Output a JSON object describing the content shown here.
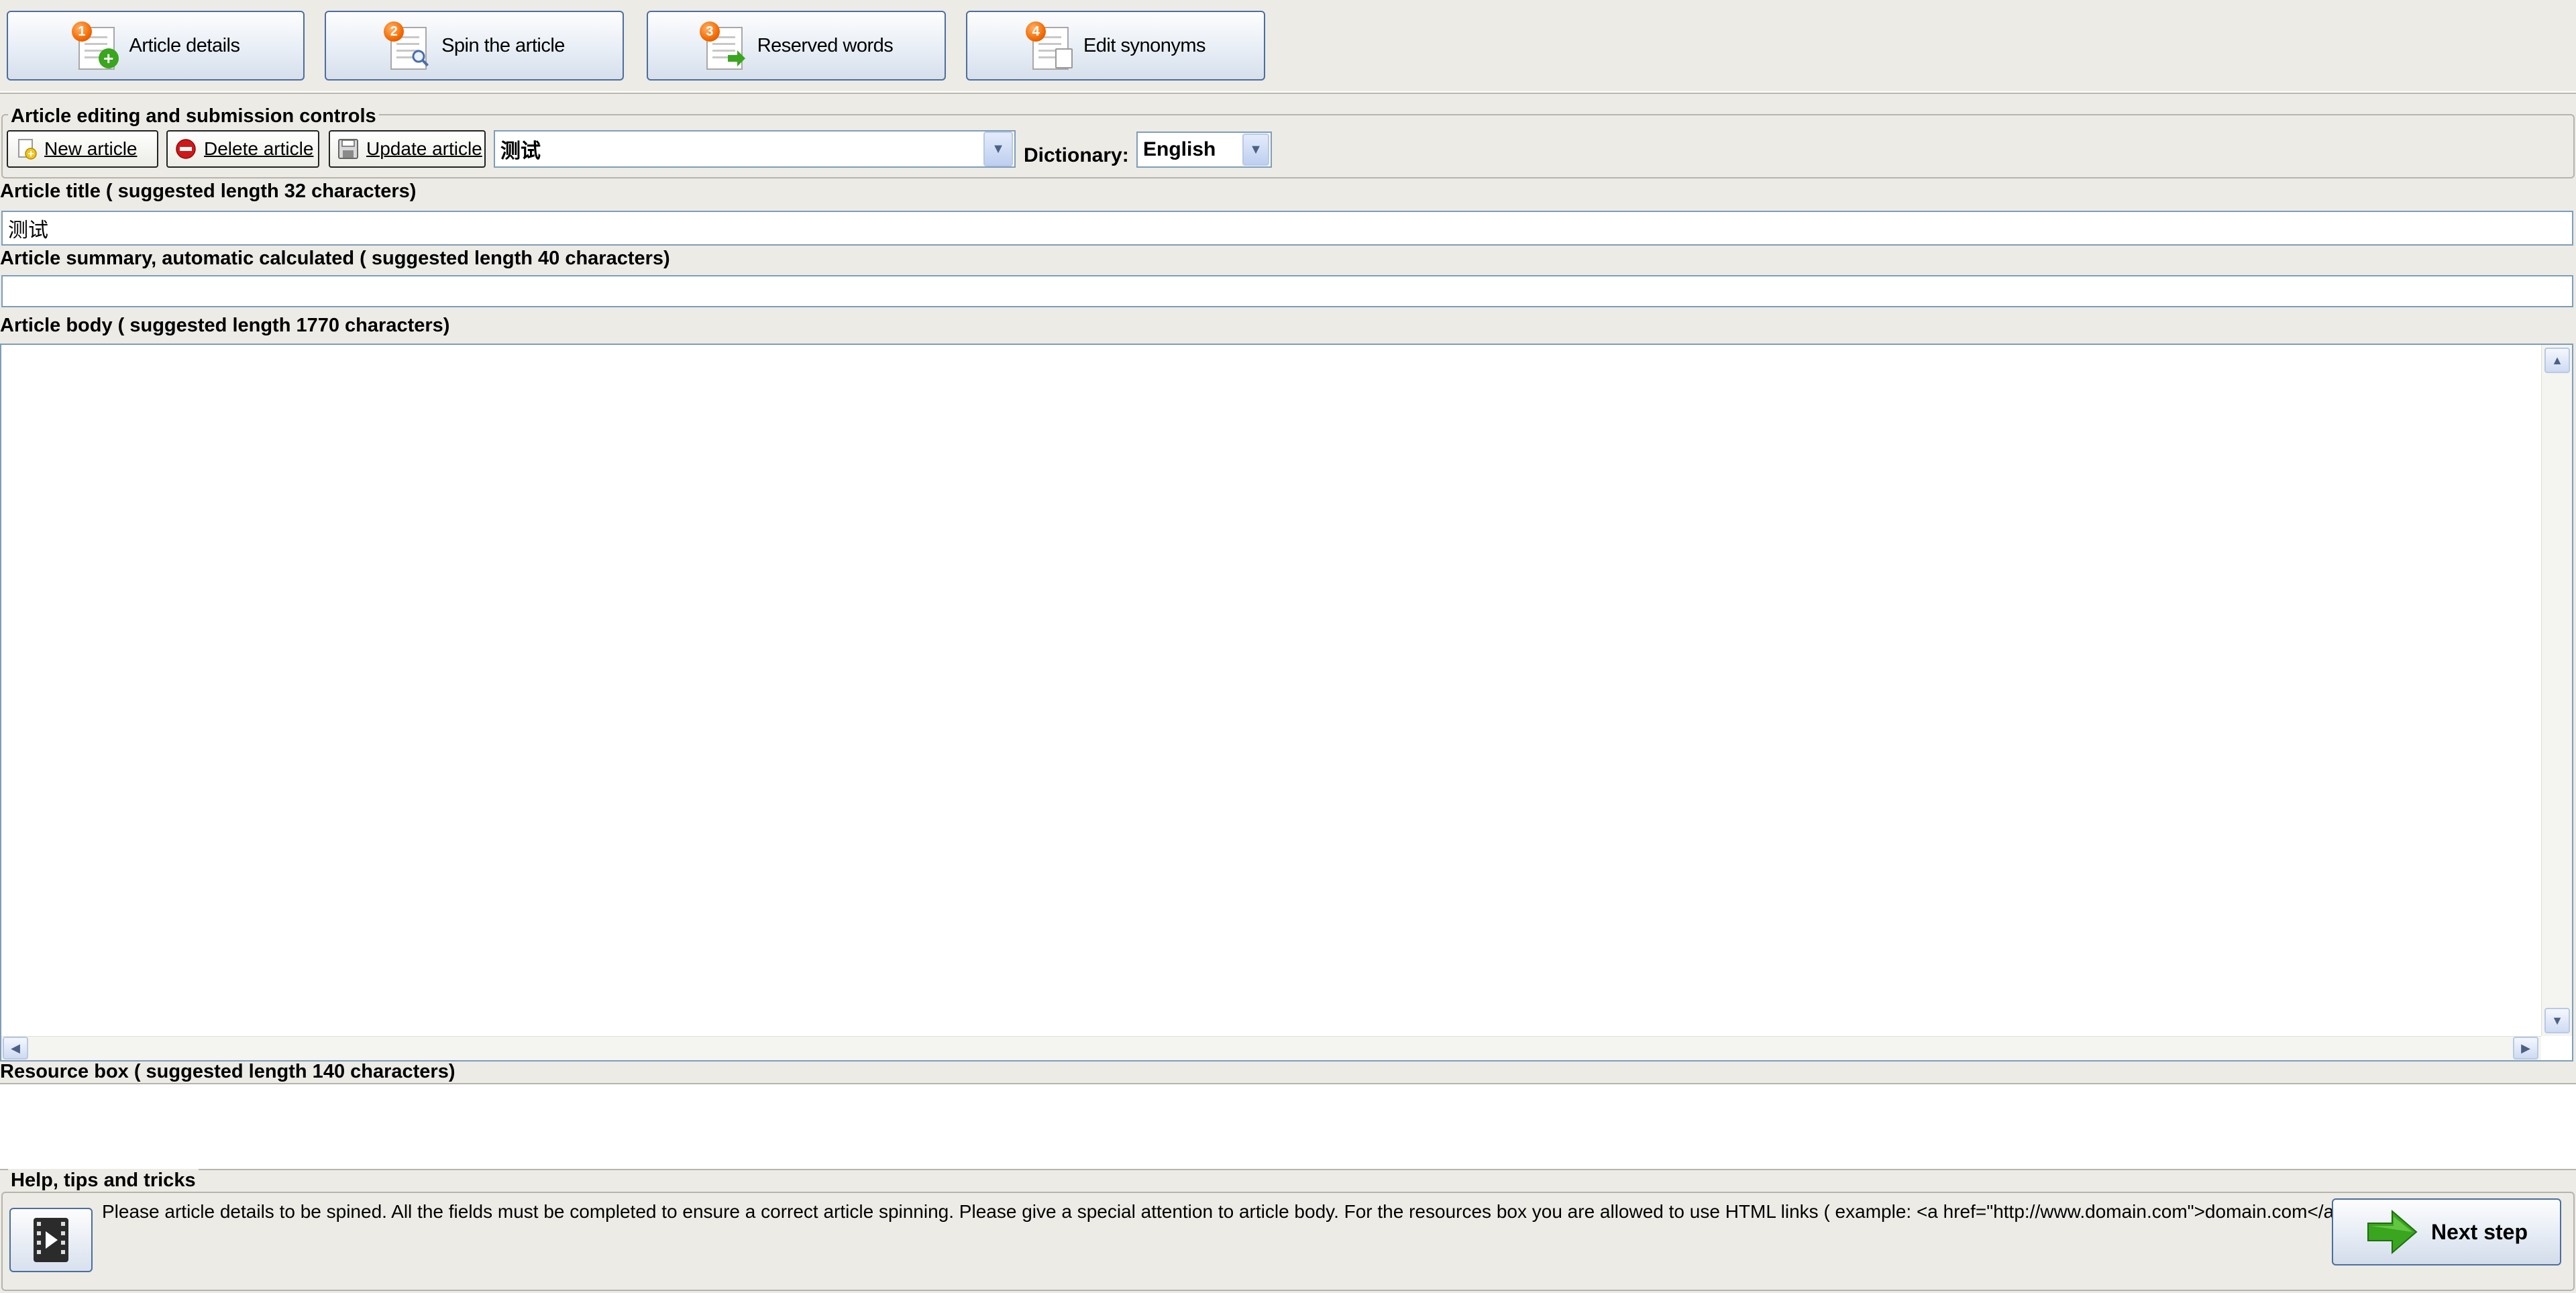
{
  "steps": [
    {
      "number": "1",
      "label": "Article details"
    },
    {
      "number": "2",
      "label": "Spin the article"
    },
    {
      "number": "3",
      "label": "Reserved words"
    },
    {
      "number": "4",
      "label": "Edit synonyms"
    }
  ],
  "controls": {
    "group_title": "Article editing and submission controls",
    "new_article": "New article",
    "delete_article": "Delete article",
    "update_article": "Update article",
    "article_select_value": "测试",
    "dictionary_label": "Dictionary:",
    "dictionary_value": "English"
  },
  "fields": {
    "title_label": "Article title ( suggested length 32 characters)",
    "title_value": "测试",
    "summary_label": "Article summary, automatic calculated ( suggested length 40 characters)",
    "summary_value": "",
    "body_label": "Article body ( suggested length 1770 characters)",
    "body_value": "",
    "resource_label": "Resource box ( suggested length 140 characters)",
    "resource_value": ""
  },
  "help": {
    "group_title": "Help, tips and tricks",
    "text": "Please article details to be spined. All the fields must be completed to ensure a correct article spinning. Please give a special attention to article body. For the resources box you are allowed to use HTML links ( example: <a href=\"http://www.domain.com\">domain.com</a> ).",
    "next_label": "Next step"
  },
  "icons": {
    "video": "video-play-icon",
    "next": "green-arrow-right-icon",
    "new": "new-document-icon",
    "delete": "delete-red-circle-icon",
    "update": "floppy-disk-icon"
  },
  "colors": {
    "accent_blue": "#4c6e9e",
    "badge_orange": "#f36a00",
    "delete_red": "#d01818",
    "next_green": "#3aa51f"
  }
}
